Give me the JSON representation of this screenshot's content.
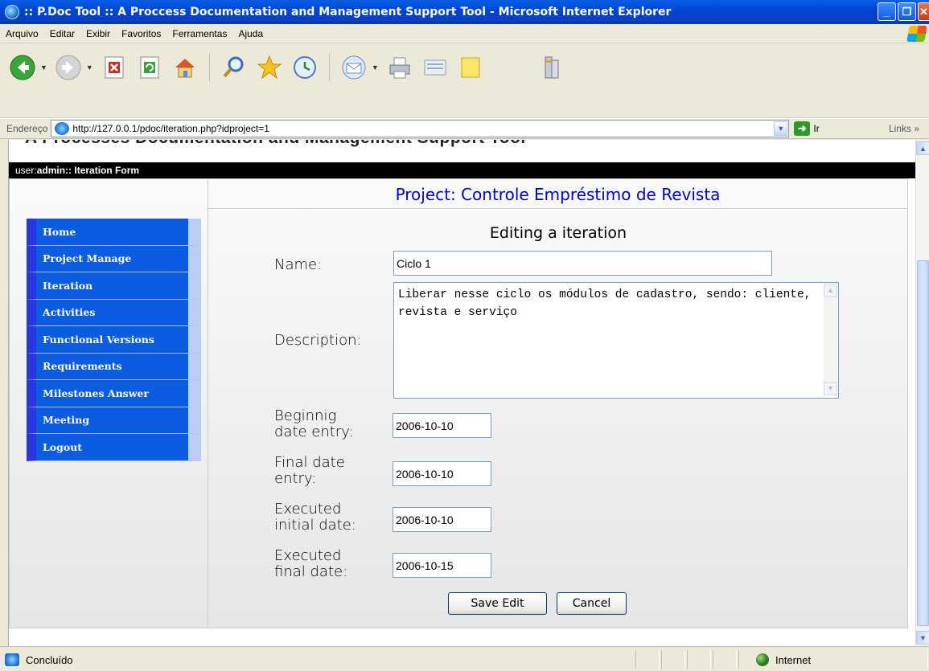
{
  "window": {
    "title": ":: P.Doc Tool :: A Proccess Documentation and Management Support Tool - Microsoft Internet Explorer"
  },
  "menu": {
    "items": [
      "Arquivo",
      "Editar",
      "Exibir",
      "Favoritos",
      "Ferramentas",
      "Ajuda"
    ]
  },
  "toolbar": {
    "icons": [
      "back-icon",
      "forward-icon",
      "stop-icon",
      "refresh-icon",
      "home-icon",
      "search-icon",
      "favorites-icon",
      "history-icon",
      "mail-icon",
      "print-icon",
      "edit-icon",
      "notes-icon",
      "messenger-icon"
    ]
  },
  "address": {
    "label": "Endereço",
    "url": "http://127.0.0.1/pdoc/iteration.php?idproject=1",
    "go_label": "Ir",
    "links_label": "Links"
  },
  "page": {
    "header_cut": "A Processes Documentation and Management Support Tool",
    "user_prefix": "user: ",
    "user": "admin",
    "user_suffix": " :: Iteration Form",
    "project_title": "Project: Controle Empréstimo de Revista"
  },
  "sidebar": {
    "items": [
      {
        "label": "Home"
      },
      {
        "label": "Project Manage"
      },
      {
        "label": "Iteration"
      },
      {
        "label": "Activities"
      },
      {
        "label": "Functional Versions"
      },
      {
        "label": "Requirements"
      },
      {
        "label": "Milestones Answer"
      },
      {
        "label": "Meeting"
      },
      {
        "label": "Logout"
      }
    ]
  },
  "form": {
    "title": "Editing a iteration",
    "name_label": "Name:",
    "name_value": "Ciclo 1",
    "description_label": "Description:",
    "description_value": "Liberar nesse ciclo os módulos de cadastro, sendo: cliente, revista e serviço",
    "begin_label_1": "Beginnig",
    "begin_label_2": "date entry:",
    "begin_value": "2006-10-10",
    "final_label_1": "Final date",
    "final_label_2": "entry:",
    "final_value": "2006-10-10",
    "exec_init_label_1": "Executed",
    "exec_init_label_2": "initial date:",
    "exec_init_value": "2006-10-10",
    "exec_final_label_1": "Executed",
    "exec_final_label_2": "final date:",
    "exec_final_value": "2006-10-15",
    "save_label": "Save Edit",
    "cancel_label": "Cancel"
  },
  "status": {
    "text": "Concluído",
    "zone": "Internet"
  }
}
